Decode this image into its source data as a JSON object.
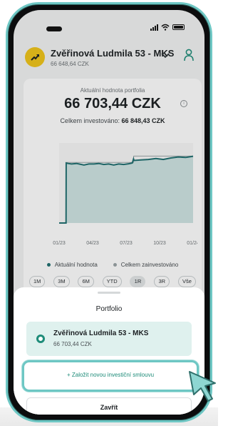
{
  "account": {
    "name": "Zvěřinová Ludmila 53 - MKS",
    "balance": "66 648,64 CZK"
  },
  "portfolio": {
    "label": "Aktuální hodnota portfolia",
    "value": "66 703,44 CZK",
    "invested_label": "Celkem investováno:",
    "invested_value": "66 848,43 CZK"
  },
  "chart_data": {
    "type": "line",
    "x_ticks": [
      "01/23",
      "04/23",
      "07/23",
      "10/23",
      "01/24"
    ],
    "series": [
      {
        "name": "Aktuální hodnota",
        "points": [
          [
            0.0,
            0
          ],
          [
            2.8,
            0
          ],
          [
            2.85,
            60000
          ],
          [
            3.6,
            59500
          ],
          [
            5.0,
            59000
          ],
          [
            7.0,
            59500
          ],
          [
            8.0,
            59000
          ],
          [
            10.0,
            58000
          ],
          [
            12.0,
            59000
          ],
          [
            14.0,
            59000
          ],
          [
            16.0,
            59500
          ],
          [
            18.0,
            58500
          ],
          [
            20.0,
            59000
          ],
          [
            22.0,
            58000
          ],
          [
            24.0,
            59000
          ],
          [
            26.0,
            58500
          ],
          [
            28.0,
            59200
          ],
          [
            29.5,
            60000
          ],
          [
            30.0,
            64000
          ],
          [
            30.2,
            62500
          ],
          [
            33.0,
            63000
          ],
          [
            36.0,
            63500
          ],
          [
            39.0,
            64500
          ],
          [
            42.0,
            63500
          ],
          [
            45.0,
            65000
          ],
          [
            48.0,
            66000
          ],
          [
            51.0,
            65500
          ],
          [
            54.0,
            66700
          ]
        ]
      },
      {
        "name": "Celkem zainvestováno",
        "points": [
          [
            0.0,
            0
          ],
          [
            2.8,
            0
          ],
          [
            2.85,
            60500
          ],
          [
            30.0,
            60500
          ],
          [
            30.05,
            66848
          ],
          [
            54.0,
            66848
          ]
        ]
      }
    ],
    "legend": [
      "Aktuální hodnota",
      "Celkem zainvestováno"
    ],
    "colors": {
      "value": "#1e6f70",
      "invested": "#9aa3a6",
      "fill": "#cfe4e3"
    }
  },
  "periods": [
    "1M",
    "3M",
    "6M",
    "YTD",
    "1R",
    "3R",
    "Vše"
  ],
  "active_period": "1R",
  "sheet": {
    "title": "Portfolio",
    "contract_name": "Zvěřinová Ludmila 53 - MKS",
    "contract_value": "66 703,44 CZK",
    "add_label": "+  Založit novou investiční smlouvu",
    "close_label": "Zavřít"
  }
}
